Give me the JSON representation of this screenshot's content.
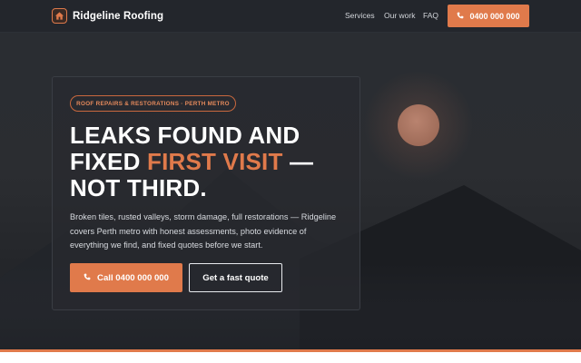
{
  "header": {
    "brand_name": "Ridgeline Roofing",
    "logo_icon": "house-icon",
    "nav": [
      "Services",
      "Our work",
      "FAQ"
    ],
    "cta_label": "0400 000 000",
    "cta_icon": "phone-icon"
  },
  "hero": {
    "badge": "ROOF REPAIRS & RESTORATIONS · PERTH METRO",
    "headline_line1": "LEAKS FOUND AND",
    "headline_line2_pre": "FIXED ",
    "headline_accent": "FIRST VISIT",
    "headline_line2_post": " —",
    "headline_line3": "NOT THIRD.",
    "lead": "Broken tiles, rusted valleys, storm damage, full restorations — Ridgeline covers Perth metro with honest assessments, photo evidence of everything we find, and fixed quotes before we start.",
    "primary_button": "Call 0400 000 000",
    "secondary_button": "Get a fast quote"
  },
  "colors": {
    "accent": "#e07a4b",
    "header_bg": "#23262c",
    "hero_bg": "#2b2d31"
  }
}
